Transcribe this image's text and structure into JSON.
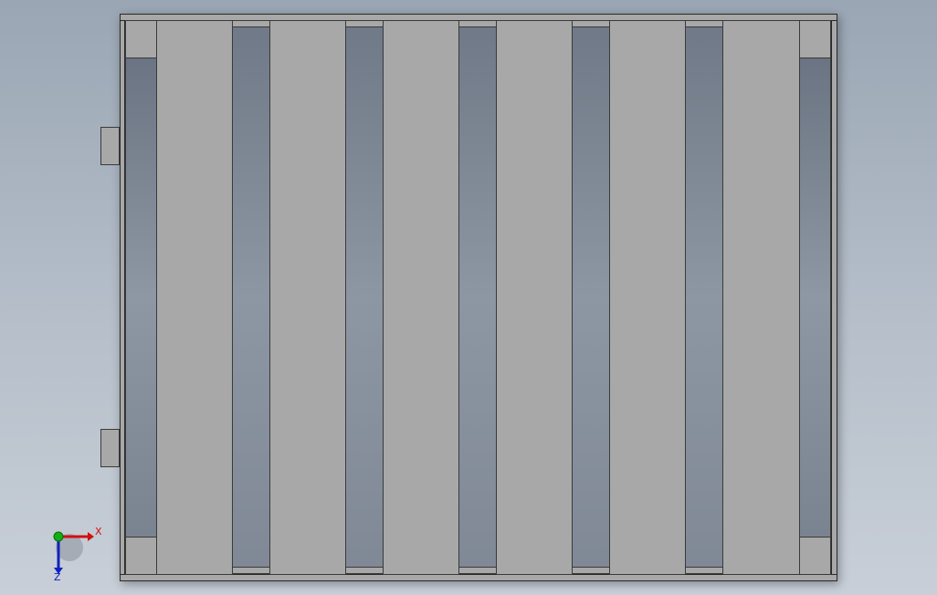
{
  "view": {
    "name": "top view",
    "slat_count": 6,
    "colors": {
      "background_top": "#9aa6b4",
      "background_bottom": "#c8cfd8",
      "part": "#a8a8a8",
      "edge": "#3a3a3a",
      "axis_x": "#d01010",
      "axis_y": "#10b010",
      "axis_z": "#1020c0"
    }
  },
  "triad": {
    "x_label": "X",
    "z_label": "Z",
    "icons": [
      "x-axis-arrow",
      "y-axis-dot",
      "z-axis-arrow"
    ]
  }
}
